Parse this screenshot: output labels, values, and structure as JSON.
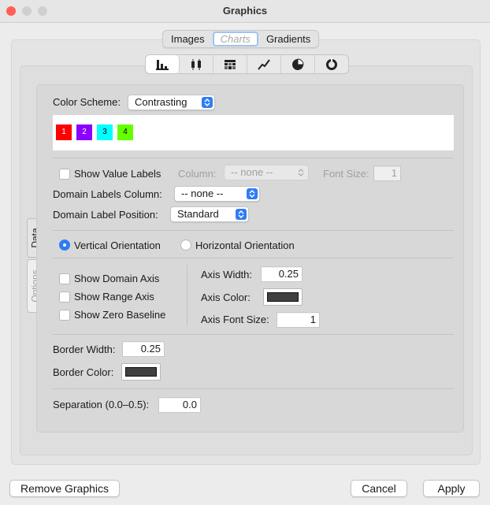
{
  "window": {
    "title": "Graphics"
  },
  "top_tabs": [
    {
      "label": "Images"
    },
    {
      "label": "Charts"
    },
    {
      "label": "Gradients"
    }
  ],
  "chart_type_icons": [
    "bar-chart-icon",
    "box-plot-icon",
    "table-chart-icon",
    "line-chart-icon",
    "pie-chart-icon",
    "donut-chart-icon"
  ],
  "side_tabs": {
    "data": "Data",
    "options": "Options"
  },
  "color_scheme": {
    "label": "Color Scheme:",
    "value": "Contrasting",
    "swatches": [
      {
        "label": "1",
        "color": "#ff0000"
      },
      {
        "label": "2",
        "color": "#8b00ff"
      },
      {
        "label": "3",
        "color": "#00ffff"
      },
      {
        "label": "4",
        "color": "#66ff00"
      }
    ]
  },
  "value_labels": {
    "show_label": "Show Value Labels",
    "column_label": "Column:",
    "column_value": "-- none --",
    "font_size_label": "Font Size:",
    "font_size_value": "1"
  },
  "domain_labels": {
    "column_label": "Domain Labels Column:",
    "column_value": "-- none --",
    "position_label": "Domain Label Position:",
    "position_value": "Standard"
  },
  "orientation": {
    "vertical": "Vertical Orientation",
    "horizontal": "Horizontal Orientation",
    "selected": "vertical"
  },
  "axis": {
    "show_domain": "Show Domain Axis",
    "show_range": "Show Range Axis",
    "show_zero": "Show Zero Baseline",
    "width_label": "Axis Width:",
    "width_value": "0.25",
    "color_label": "Axis Color:",
    "color": "#404040",
    "font_size_label": "Axis Font Size:",
    "font_size_value": "1"
  },
  "border": {
    "width_label": "Border Width:",
    "width_value": "0.25",
    "color_label": "Border Color:",
    "color": "#404040"
  },
  "separation": {
    "label": "Separation (0.0–0.5):",
    "value": "0.0"
  },
  "buttons": {
    "remove": "Remove Graphics",
    "cancel": "Cancel",
    "apply": "Apply"
  },
  "colors": {
    "accent": "#2f7cf6",
    "close": "#ff5f57"
  }
}
